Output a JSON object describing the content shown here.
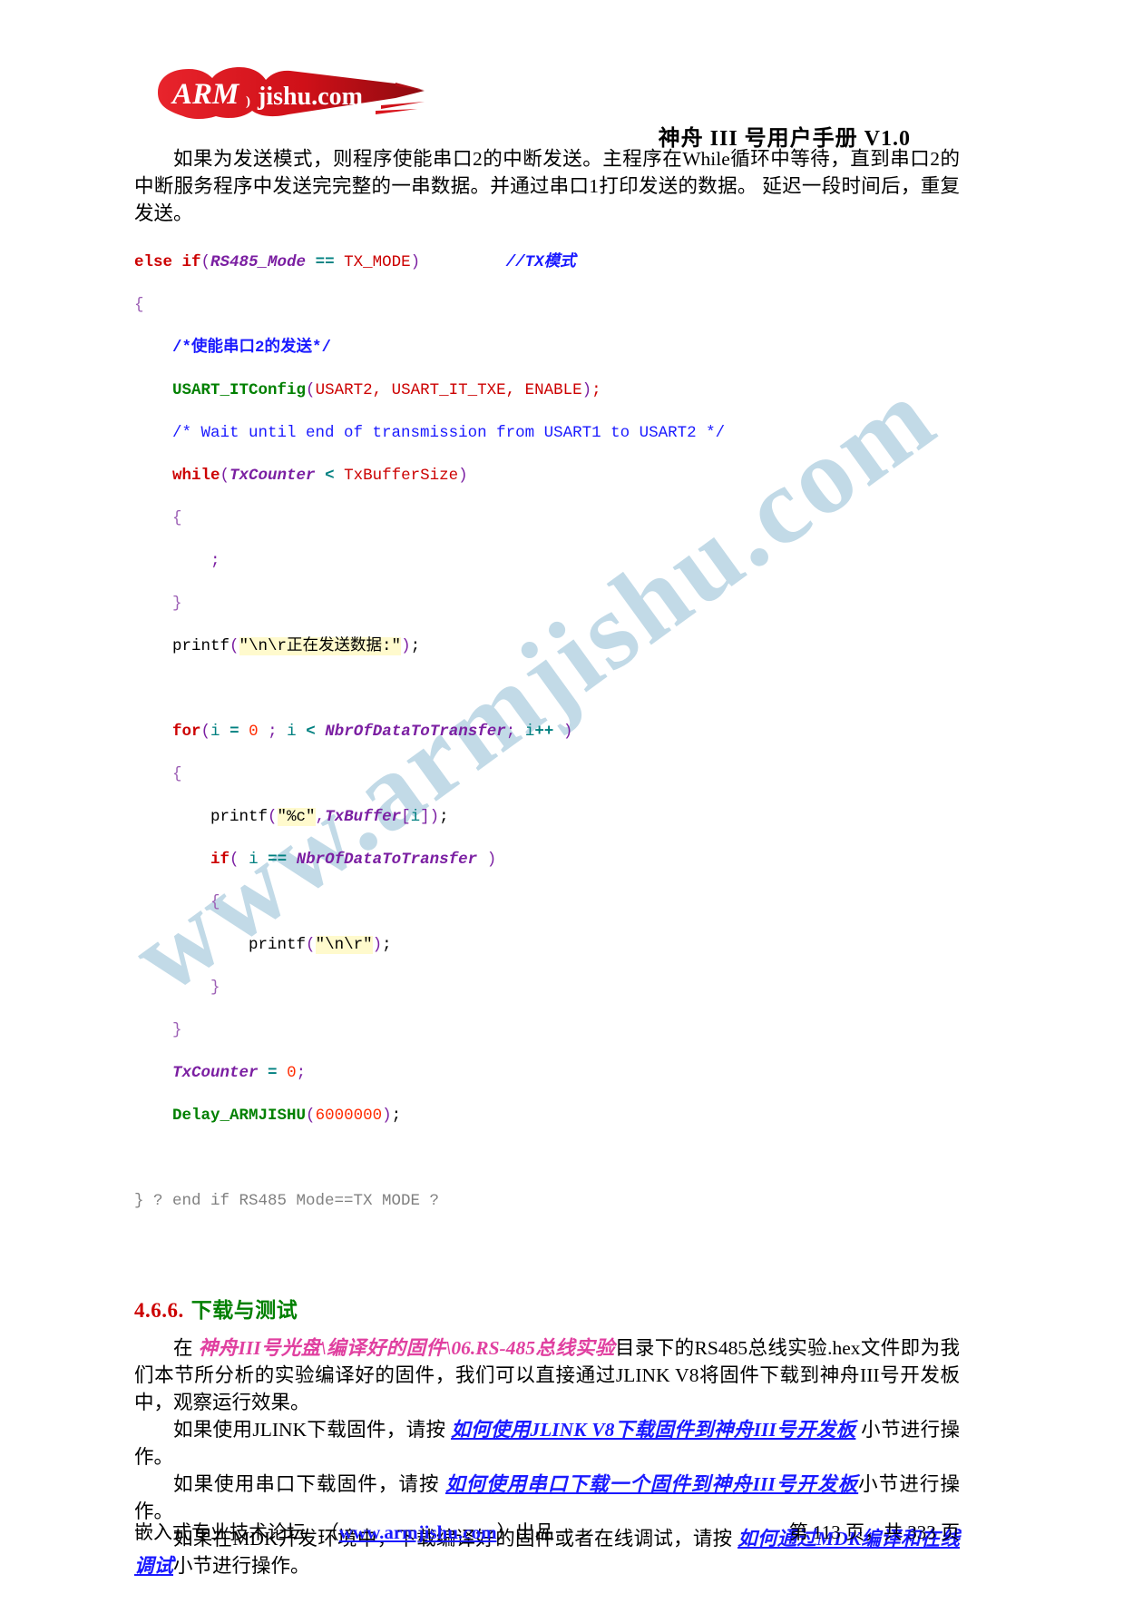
{
  "header": {
    "logo_alt": "ARMjishu.com",
    "logo_text_arm": "ARM",
    "logo_text_rest": "jishu.com",
    "doc_title": "神舟 III 号用户手册  V1.0"
  },
  "watermark": {
    "text": "www.armjishu.com"
  },
  "intro": {
    "paragraph": "如果为发送模式，则程序使能串口2的中断发送。主程序在While循环中等待，直到串口2的中断服务程序中发送完完整的一串数据。并通过串口1打印发送的数据。 延迟一段时间后，重复发送。"
  },
  "code_block": {
    "lines": [
      "else if(RS485_Mode == TX_MODE)            //TX模式",
      "{",
      "    /*使能串口2的发送*/",
      "    USART_ITConfig(USART2, USART_IT_TXE, ENABLE);",
      "    /* Wait until end of transmission from USART1 to USART2 */",
      "    while(TxCounter < TxBufferSize)",
      "    {",
      "        ;",
      "    }",
      "    printf(\"\\n\\r正在发送数据:\");",
      "",
      "    for(i = 0 ; i < NbrOfDataToTransfer; i++ )",
      "    {",
      "        printf(\"%c\",TxBuffer[i]);",
      "        if( i == NbrOfDataToTransfer )",
      "        {",
      "            printf(\"\\n\\r\");",
      "        }",
      "    }",
      "    TxCounter = 0;",
      "    Delay_ARMJISHU(6000000);",
      "",
      "} ? end if RS485 Mode==TX MODE ?"
    ]
  },
  "section": {
    "number": "4.6.6.",
    "title": "下载与测试",
    "para1_a": "在 ",
    "para1_path": "神舟III号光盘\\编译好的固件\\06.RS-485总线实验",
    "para1_b": "目录下的RS485总线实验.hex文件即为我们本节所分析的实验编译好的固件，我们可以直接通过JLINK V8将固件下载到神舟III号开发板中，观察运行效果。",
    "para2_a": "如果使用JLINK下载固件，请按 ",
    "para2_link": "如何使用JLINK V8下载固件到神舟III号开发板",
    "para2_b": " 小节进行操作。",
    "para3_a": "如果使用串口下载固件，请按 ",
    "para3_link": "如何使用串口下载一个固件到神舟III号开发板",
    "para3_b": "小节进行操作。",
    "para4_a": "如果在MDK开发环境中，下载编译好的固件或者在线调试，请按 ",
    "para4_link": "如何通过MDK编译和在线调试",
    "para4_b": "小节进行操作。"
  },
  "footer": {
    "left_pre": "嵌入式专业技术论坛 　（",
    "left_link": "www.armjishu.com",
    "left_post": "）出品",
    "right": "第 113 页，共 333 页"
  },
  "colors": {
    "keyword": "#cc0000",
    "function": "#008000",
    "variable": "#7b1fa2",
    "comment": "#1a1aff",
    "string_highlight": "#fffacd",
    "link": "#1a1aff",
    "heading": "#008000",
    "brand_red": "#d8141c",
    "watermark": "#b8d4e3"
  }
}
